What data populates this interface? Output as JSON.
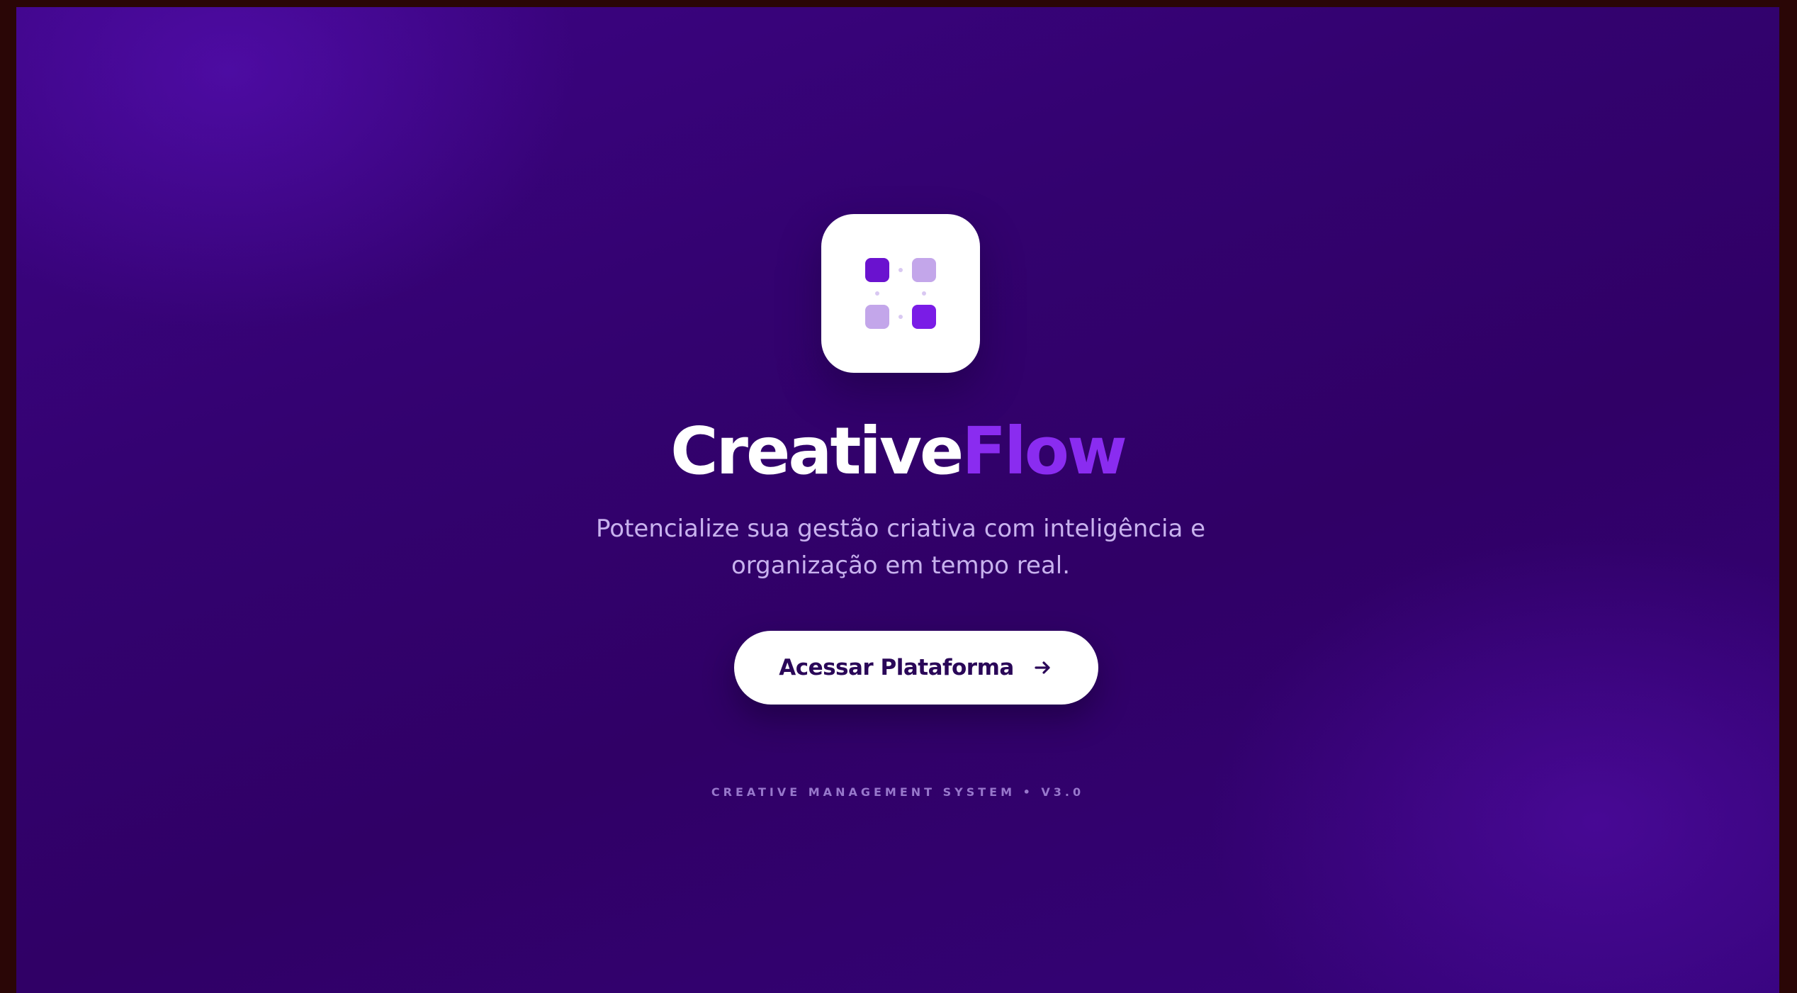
{
  "brand": {
    "name_part1": "Creative",
    "name_part2": "Flow",
    "icon": "app-grid-icon",
    "accent_color": "#8a2cf0",
    "background_color": "#32026d"
  },
  "hero": {
    "subtitle": "Potencialize sua gestão criativa com inteligência e organização em tempo real."
  },
  "cta": {
    "label": "Acessar Plataforma",
    "icon": "arrow-right-icon"
  },
  "footer": {
    "text": "CREATIVE MANAGEMENT SYSTEM • V3.0"
  }
}
